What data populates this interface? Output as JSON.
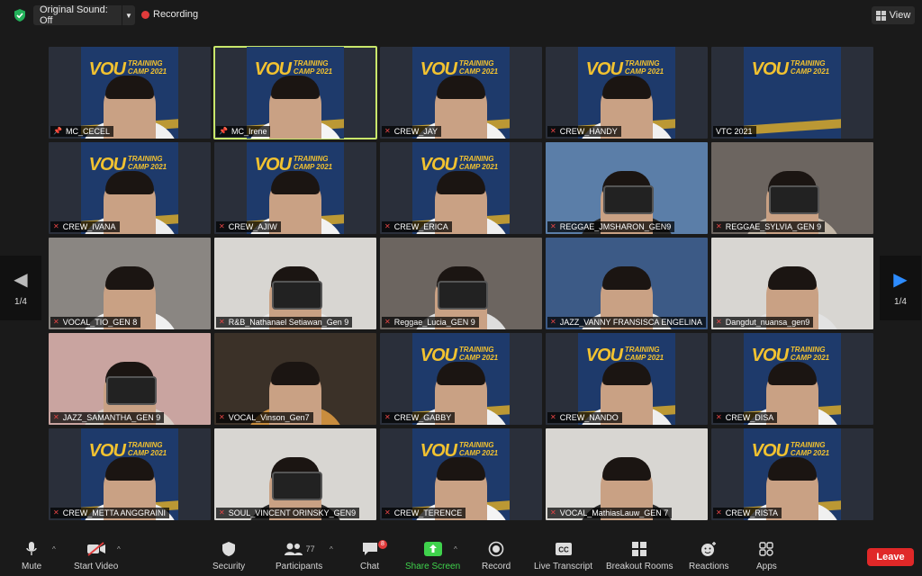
{
  "topbar": {
    "original_sound": "Original Sound: Off",
    "recording": "Recording",
    "view": "View"
  },
  "colors": {
    "active_speaker": "#c9e76b",
    "record": "#e03b3b",
    "share_green": "#3fd24c",
    "leave_red": "#e02828",
    "banner_blue": "#1e3a6b",
    "banner_yellow": "#f2c230"
  },
  "banner": {
    "title": "VOU",
    "subtitle_line1": "TRAINING",
    "subtitle_line2": "CAMP 2021"
  },
  "participants": [
    {
      "name": "MC_CECEL",
      "bg": "banner",
      "pin": true,
      "muted": false,
      "shirt": "#f0f0f0"
    },
    {
      "name": "MC_Irene",
      "bg": "banner",
      "pin": true,
      "muted": false,
      "active": true,
      "shirt": "#f4f4f4"
    },
    {
      "name": "CREW_JAY",
      "bg": "banner",
      "muted": true,
      "shirt": "#f2f2f2"
    },
    {
      "name": "CREW_HANDY",
      "bg": "banner",
      "muted": true,
      "shirt": "#f0f0f0"
    },
    {
      "name": "VTC 2021",
      "bg": "banner",
      "muted": false,
      "empty": true
    },
    {
      "name": "CREW_IVANA",
      "bg": "banner",
      "muted": true,
      "shirt": "#eee"
    },
    {
      "name": "CREW_AJIW",
      "bg": "banner",
      "muted": true,
      "shirt": "#f2f2f2"
    },
    {
      "name": "CREW_ERICA",
      "bg": "banner",
      "muted": true,
      "shirt": "#efefef"
    },
    {
      "name": "REGGAE_JMSHARON_GEN9",
      "bg": "city",
      "muted": true,
      "phone": true,
      "shirt": "#2a2a2a"
    },
    {
      "name": "REGGAE_SYLVIA_GEN 9",
      "bg": "room",
      "muted": true,
      "phone": true,
      "shirt": "#c4b8a8"
    },
    {
      "name": "VOCAL_TIO_GEN 8",
      "bg": "grey",
      "muted": true,
      "shirt": "#f0f0f0"
    },
    {
      "name": "R&B_Nathanael Setiawan_Gen 9",
      "bg": "white",
      "muted": true,
      "phone": true,
      "shirt": "#e8e8e8"
    },
    {
      "name": "Reggae_Lucia_GEN 9",
      "bg": "room",
      "muted": true,
      "phone": true,
      "shirt": "#ddd"
    },
    {
      "name": "JAZZ_VANNY FRANSISCA ENGELINA",
      "bg": "sky",
      "muted": true,
      "shirt": "#eaeaea"
    },
    {
      "name": "Dangdut_nuansa_gen9",
      "bg": "white",
      "muted": true,
      "shirt": "#e2e2e2"
    },
    {
      "name": "JAZZ_SAMANTHA_GEN 9",
      "bg": "pink",
      "muted": true,
      "phone": true,
      "shirt": "#d9cfc6"
    },
    {
      "name": "VOCAL_Vinson_Gen7",
      "bg": "dark",
      "muted": true,
      "shirt": "#c98d3e"
    },
    {
      "name": "CREW_GABBY",
      "bg": "banner",
      "muted": true,
      "shirt": "#f0f0f0"
    },
    {
      "name": "CREW_NANDO",
      "bg": "banner",
      "muted": true,
      "shirt": "#efefef"
    },
    {
      "name": "CREW_DISA",
      "bg": "banner",
      "muted": true,
      "shirt": "#f3f3f3"
    },
    {
      "name": "CREW_METTA ANGGRAINI",
      "bg": "banner",
      "muted": true,
      "shirt": "#efefef"
    },
    {
      "name": "SOUL_VINCENT ORINSKY_GEN9",
      "bg": "white",
      "muted": true,
      "phone": true,
      "shirt": "#2a2a2a"
    },
    {
      "name": "CREW_TERENCE",
      "bg": "banner",
      "muted": true,
      "shirt": "#f4f4f4"
    },
    {
      "name": "VOCAL_MathiasLauw_GEN 7",
      "bg": "white",
      "muted": true,
      "shirt": "#2b2b2b"
    },
    {
      "name": "CREW_RISTA",
      "bg": "banner",
      "muted": true,
      "shirt": "#f0f0f0"
    }
  ],
  "pager": {
    "left": "1/4",
    "right": "1/4"
  },
  "toolbar": {
    "mute": "Mute",
    "start_video": "Start Video",
    "security": "Security",
    "participants": "Participants",
    "participants_count": "77",
    "chat": "Chat",
    "chat_badge": "8",
    "share_screen": "Share Screen",
    "record": "Record",
    "live_transcript": "Live Transcript",
    "breakout_rooms": "Breakout Rooms",
    "reactions": "Reactions",
    "apps": "Apps",
    "leave": "Leave"
  }
}
